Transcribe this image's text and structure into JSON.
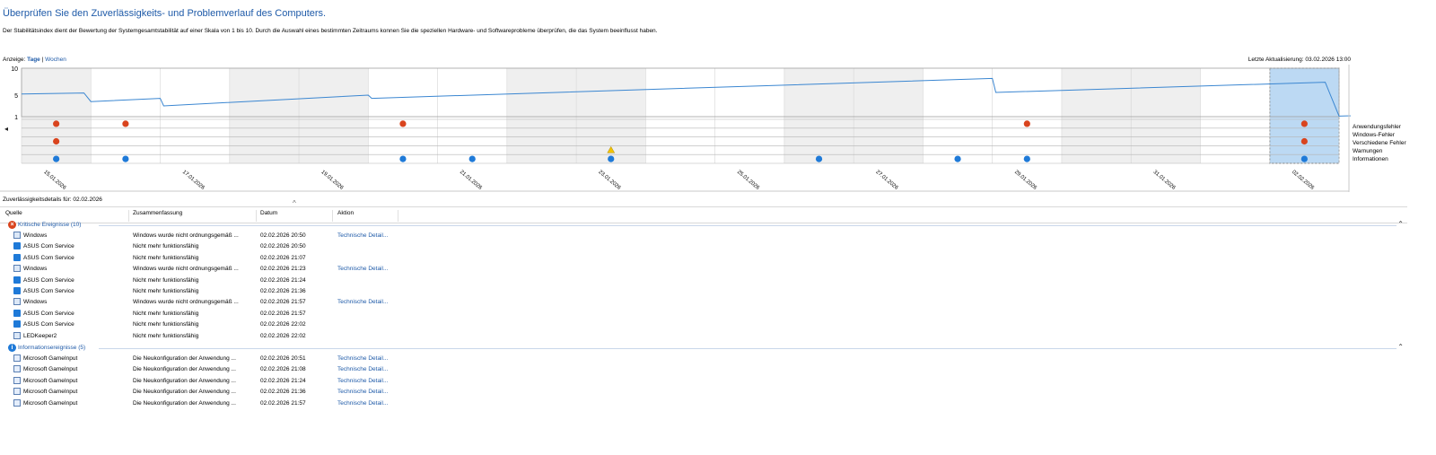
{
  "header": {
    "title": "Überprüfen Sie den Zuverlässigkeits- und Problemverlauf des Computers.",
    "description": "Der Stabilitätsindex dient der Bewertung der Systemgesamtstabilität auf einer Skala von 1 bis 10. Durch die Auswahl eines bestimmten Zeitraums konnen Sie die speziellen Hardware- und Softwareprobleme überprüfen, die das System beeinflusst haben.",
    "view_label": "Anzeige:",
    "view_days": "Tage",
    "view_separator": "|",
    "view_weeks": "Wochen",
    "last_update": "Letzte Aktualisierung: 03.02.2026 13:00"
  },
  "chart_data": {
    "type": "line",
    "ylim": [
      1,
      10
    ],
    "yticks": [
      "10",
      "5",
      "1"
    ],
    "days": 19,
    "x_labels": [
      "15.01.2026",
      "17.01.2026",
      "19.01.2026",
      "21.01.2026",
      "23.01.2026",
      "25.01.2026",
      "27.01.2026",
      "29.01.2026",
      "31.01.2026",
      "02.02.2026"
    ],
    "x_label_days": [
      0,
      2,
      4,
      6,
      8,
      10,
      12,
      14,
      16,
      18
    ],
    "selected_day": 18,
    "stability_points": [
      [
        0,
        5.2
      ],
      [
        0.9,
        5.4
      ],
      [
        1.0,
        3.8
      ],
      [
        2.0,
        4.4
      ],
      [
        2.05,
        3.0
      ],
      [
        5.0,
        5.0
      ],
      [
        5.05,
        4.4
      ],
      [
        14.0,
        8.1
      ],
      [
        14.05,
        5.5
      ],
      [
        18.8,
        7.4
      ],
      [
        19.0,
        1.1
      ],
      [
        19.9,
        1.5
      ],
      [
        20.0,
        1.0
      ]
    ],
    "legend": [
      "Anwendungsfehler",
      "Windows-Fehler",
      "Verschiedene Fehler",
      "Warnungen",
      "Informationen"
    ],
    "events": {
      "Anwendungsfehler": [
        0,
        1,
        5,
        14,
        18,
        19
      ],
      "Windows-Fehler": [],
      "Verschiedene Fehler": [
        0,
        18,
        19
      ],
      "Warnungen": [
        8
      ],
      "Informationen": [
        0,
        1,
        5,
        6,
        8,
        11,
        13,
        14,
        18,
        19
      ]
    },
    "colors": {
      "line": "#3a86d1",
      "error": "#d9441e",
      "warning": "#f2c200",
      "info": "#1f7ad8",
      "selected": "#bcd9f3",
      "shade": "#efefef"
    }
  },
  "details_label": "Zuverlässigkeitsdetails für: 02.02.2026",
  "columns": [
    "Quelle",
    "Zusammenfassung",
    "Datum",
    "Aktion"
  ],
  "groups": [
    {
      "label": "Kritische Ereignisse (10)",
      "icon": "error-icon",
      "rows": [
        {
          "icon": "win",
          "source": "Windows",
          "summary": "Windows wurde nicht ordnungsgemäß ...",
          "date": "02.02.2026 20:50",
          "action": "Technische Detail..."
        },
        {
          "icon": "app",
          "source": "ASUS Com Service",
          "summary": "Nicht mehr funktionsfähig",
          "date": "02.02.2026 20:50",
          "action": ""
        },
        {
          "icon": "app",
          "source": "ASUS Com Service",
          "summary": "Nicht mehr funktionsfähig",
          "date": "02.02.2026 21:07",
          "action": ""
        },
        {
          "icon": "win",
          "source": "Windows",
          "summary": "Windows wurde nicht ordnungsgemäß ...",
          "date": "02.02.2026 21:23",
          "action": "Technische Detail..."
        },
        {
          "icon": "app",
          "source": "ASUS Com Service",
          "summary": "Nicht mehr funktionsfähig",
          "date": "02.02.2026 21:24",
          "action": ""
        },
        {
          "icon": "app",
          "source": "ASUS Com Service",
          "summary": "Nicht mehr funktionsfähig",
          "date": "02.02.2026 21:36",
          "action": ""
        },
        {
          "icon": "win",
          "source": "Windows",
          "summary": "Windows wurde nicht ordnungsgemäß ...",
          "date": "02.02.2026 21:57",
          "action": "Technische Detail..."
        },
        {
          "icon": "app",
          "source": "ASUS Com Service",
          "summary": "Nicht mehr funktionsfähig",
          "date": "02.02.2026 21:57",
          "action": ""
        },
        {
          "icon": "app",
          "source": "ASUS Com Service",
          "summary": "Nicht mehr funktionsfähig",
          "date": "02.02.2026 22:02",
          "action": ""
        },
        {
          "icon": "led",
          "source": "LEDKeeper2",
          "summary": "Nicht mehr funktionsfähig",
          "date": "02.02.2026 22:02",
          "action": ""
        }
      ]
    },
    {
      "label": "Informationsereignisse (5)",
      "icon": "info-icon",
      "rows": [
        {
          "icon": "gi",
          "source": "Microsoft GameInput",
          "summary": "Die Neukonfiguration der Anwendung ...",
          "date": "02.02.2026 20:51",
          "action": "Technische Detail..."
        },
        {
          "icon": "gi",
          "source": "Microsoft GameInput",
          "summary": "Die Neukonfiguration der Anwendung ...",
          "date": "02.02.2026 21:08",
          "action": "Technische Detail..."
        },
        {
          "icon": "gi",
          "source": "Microsoft GameInput",
          "summary": "Die Neukonfiguration der Anwendung ...",
          "date": "02.02.2026 21:24",
          "action": "Technische Detail..."
        },
        {
          "icon": "gi",
          "source": "Microsoft GameInput",
          "summary": "Die Neukonfiguration der Anwendung ...",
          "date": "02.02.2026 21:36",
          "action": "Technische Detail..."
        },
        {
          "icon": "gi",
          "source": "Microsoft GameInput",
          "summary": "Die Neukonfiguration der Anwendung ...",
          "date": "02.02.2026 21:57",
          "action": "Technische Detail..."
        }
      ]
    }
  ]
}
